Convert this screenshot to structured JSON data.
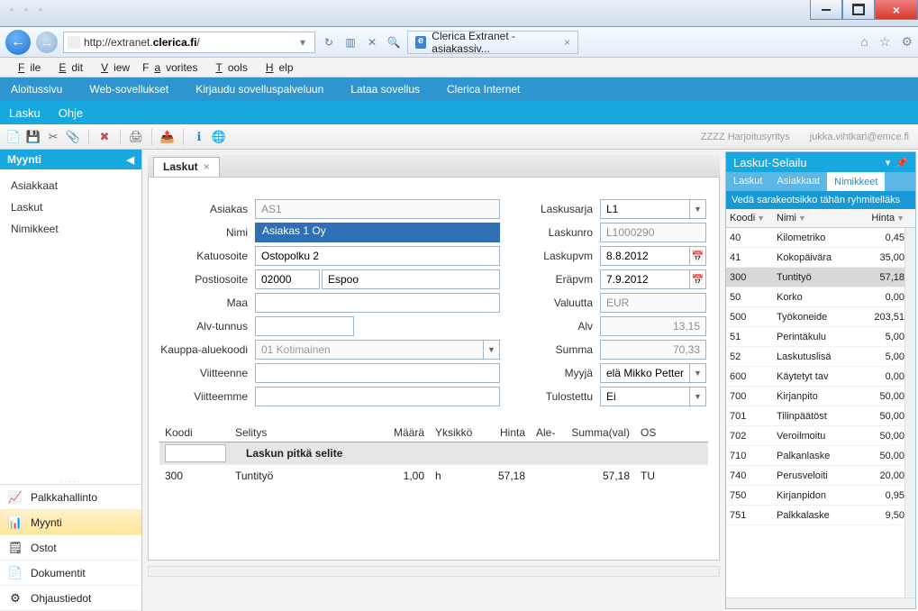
{
  "browser": {
    "url_prefix": "http://extranet.",
    "url_host": "clerica.fi",
    "url_suffix": "/",
    "tab_title": "Clerica Extranet - asiakassiv...",
    "menu": {
      "file": "File",
      "edit": "Edit",
      "view": "View",
      "favorites": "Favorites",
      "tools": "Tools",
      "help": "Help"
    }
  },
  "app": {
    "top_menu": {
      "home": "Aloitussivu",
      "webapps": "Web-sovellukset",
      "login": "Kirjaudu sovelluspalveluun",
      "download": "Lataa sovellus",
      "internet": "Clerica Internet"
    },
    "sub_menu": {
      "invoice": "Lasku",
      "help": "Ohje"
    },
    "tenant": "ZZZZ Harjoitusyritys",
    "user": "jukka.vihtkari@emce.fi"
  },
  "sidebar": {
    "header": "Myynti",
    "items": [
      "Asiakkaat",
      "Laskut",
      "Nimikkeet"
    ],
    "modules": [
      {
        "icon": "📈",
        "label": "Palkkahallinto"
      },
      {
        "icon": "📊",
        "label": "Myynti"
      },
      {
        "icon": "🗒",
        "label": "Ostot"
      },
      {
        "icon": "📄",
        "label": "Dokumentit"
      },
      {
        "icon": "⚙",
        "label": "Ohjaustiedot"
      }
    ]
  },
  "doc": {
    "tab": "Laskut",
    "labels": {
      "asiakas": "Asiakas",
      "nimi": "Nimi",
      "katuosoite": "Katuosoite",
      "postiosoite": "Postiosoite",
      "maa": "Maa",
      "alv": "Alv-tunnus",
      "kauppa": "Kauppa-aluekoodi",
      "viitteenne": "Viitteenne",
      "viitteemme": "Viitteemme",
      "laskusarja": "Laskusarja",
      "laskunro": "Laskunro",
      "laskupvm": "Laskupvm",
      "erapvm": "Eräpvm",
      "valuutta": "Valuutta",
      "alvsum": "Alv",
      "summa": "Summa",
      "myyja": "Myyjä",
      "tulostettu": "Tulostettu"
    },
    "values": {
      "asiakas": "AS1",
      "nimi": "Asiakas 1 Oy",
      "katu": "Ostopolku 2",
      "postinro": "02000",
      "kaupunki": "Espoo",
      "maa": "",
      "alvtunnus": "",
      "kauppa": "01 Kotimainen",
      "viitteenne": "",
      "viitteemme": "",
      "laskusarja": "L1",
      "laskunro": "L1000290",
      "laskupvm": "8.8.2012",
      "erapvm": "7.9.2012",
      "valuutta": "EUR",
      "alvsum": "13,15",
      "summa": "70,33",
      "myyja": "elä Mikko Petteri",
      "tulostettu": "Ei"
    },
    "lines": {
      "headers": {
        "koodi": "Koodi",
        "selitys": "Selitys",
        "maara": "Määrä",
        "yksikko": "Yksikkö",
        "hinta": "Hinta",
        "ale": "Ale-",
        "summa": "Summa(val)",
        "os": "OS"
      },
      "long_desc": "Laskun pitkä selite",
      "row": {
        "koodi": "300",
        "selitys": "Tuntityö",
        "maara": "1,00",
        "yksikko": "h",
        "hinta": "57,18",
        "summa": "57,18",
        "os": "TU"
      }
    }
  },
  "right": {
    "title": "Laskut-Selailu",
    "tabs": [
      "Laskut",
      "Asiakkaat",
      "Nimikkeet"
    ],
    "groupbar": "Vedä sarakeotsikko tähän ryhmitelläks",
    "headers": {
      "koodi": "Koodi",
      "nimi": "Nimi",
      "hinta": "Hinta"
    },
    "rows": [
      {
        "koodi": "40",
        "nimi": "Kilometriko",
        "hinta": "0,45"
      },
      {
        "koodi": "41",
        "nimi": "Kokopäivära",
        "hinta": "35,00"
      },
      {
        "koodi": "300",
        "nimi": "Tuntityö",
        "hinta": "57,18",
        "sel": true
      },
      {
        "koodi": "50",
        "nimi": "Korko",
        "hinta": "0,00"
      },
      {
        "koodi": "500",
        "nimi": "Työkoneide",
        "hinta": "203,51"
      },
      {
        "koodi": "51",
        "nimi": "Perintäkulu",
        "hinta": "5,00"
      },
      {
        "koodi": "52",
        "nimi": "Laskutuslisä",
        "hinta": "5,00"
      },
      {
        "koodi": "600",
        "nimi": "Käytetyt tav",
        "hinta": "0,00"
      },
      {
        "koodi": "700",
        "nimi": "Kirjanpito",
        "hinta": "50,00"
      },
      {
        "koodi": "701",
        "nimi": "Tilinpäätöst",
        "hinta": "50,00"
      },
      {
        "koodi": "702",
        "nimi": "Veroilmoitu",
        "hinta": "50,00"
      },
      {
        "koodi": "710",
        "nimi": "Palkanlaske",
        "hinta": "50,00"
      },
      {
        "koodi": "740",
        "nimi": "Perusveloiti",
        "hinta": "20,00"
      },
      {
        "koodi": "750",
        "nimi": "Kirjanpidon",
        "hinta": "0,95"
      },
      {
        "koodi": "751",
        "nimi": "Palkkalaske",
        "hinta": "9,50"
      }
    ]
  }
}
